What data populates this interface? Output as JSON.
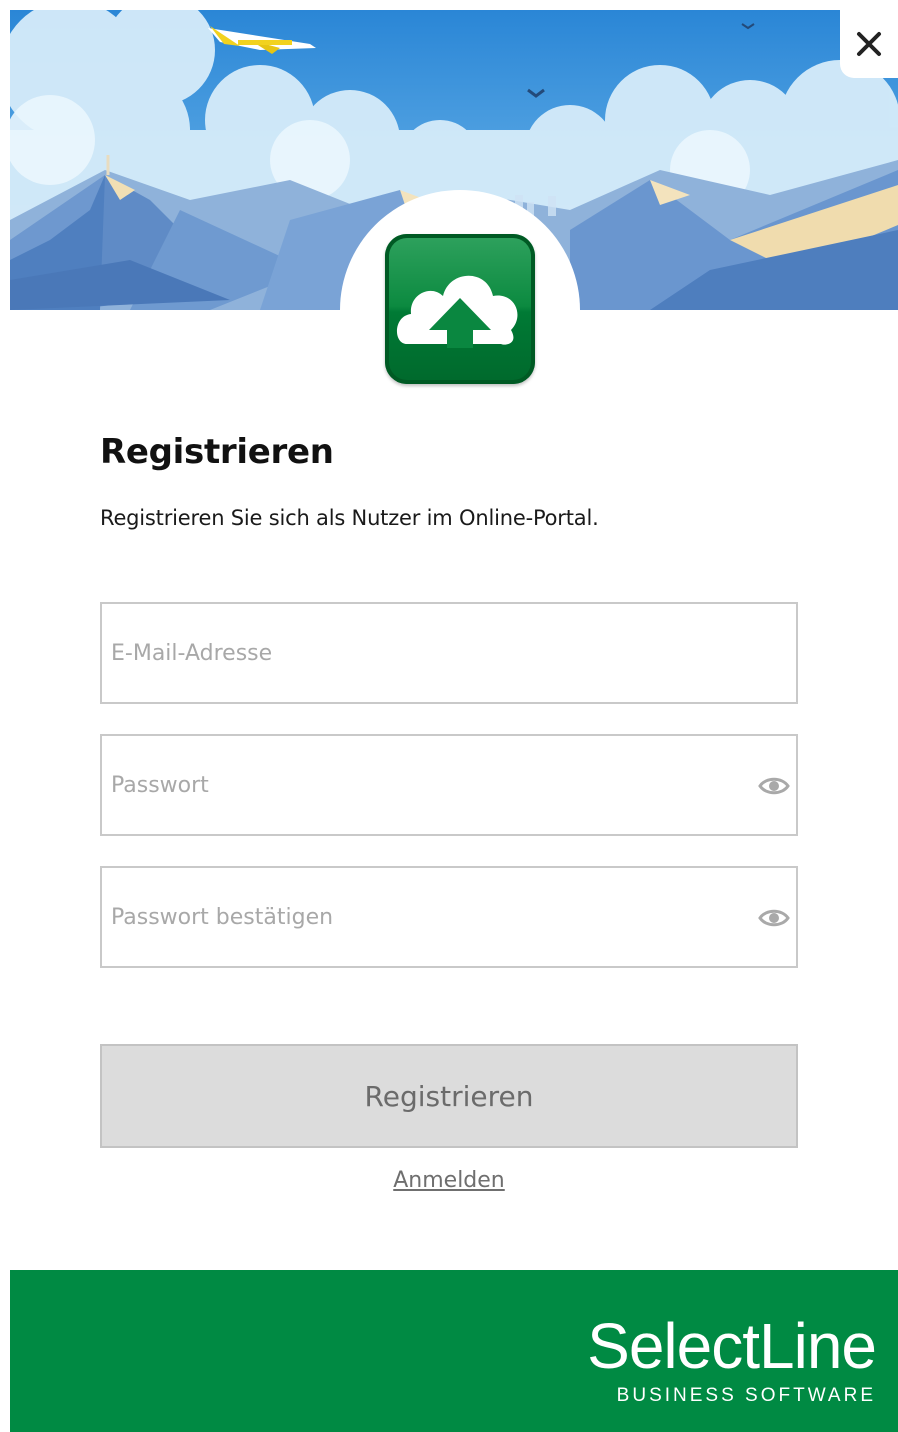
{
  "window": {
    "close_label": "×"
  },
  "form": {
    "title": "Registrieren",
    "subtitle": "Registrieren Sie sich als Nutzer im Online-Portal.",
    "email_placeholder": "E-Mail-Adresse",
    "password_placeholder": "Passwort",
    "confirm_placeholder": "Passwort bestätigen",
    "submit_label": "Registrieren",
    "login_link": "Anmelden"
  },
  "brand": {
    "name": "SelectLine",
    "tagline": "BUSINESS SOFTWARE"
  },
  "colors": {
    "brand_green": "#008a43",
    "sky": "#3b90d8",
    "button_disabled": "#dcdcdc"
  },
  "icons": {
    "app": "cloud-upload-icon",
    "close": "close-icon",
    "reveal": "eye-icon"
  }
}
